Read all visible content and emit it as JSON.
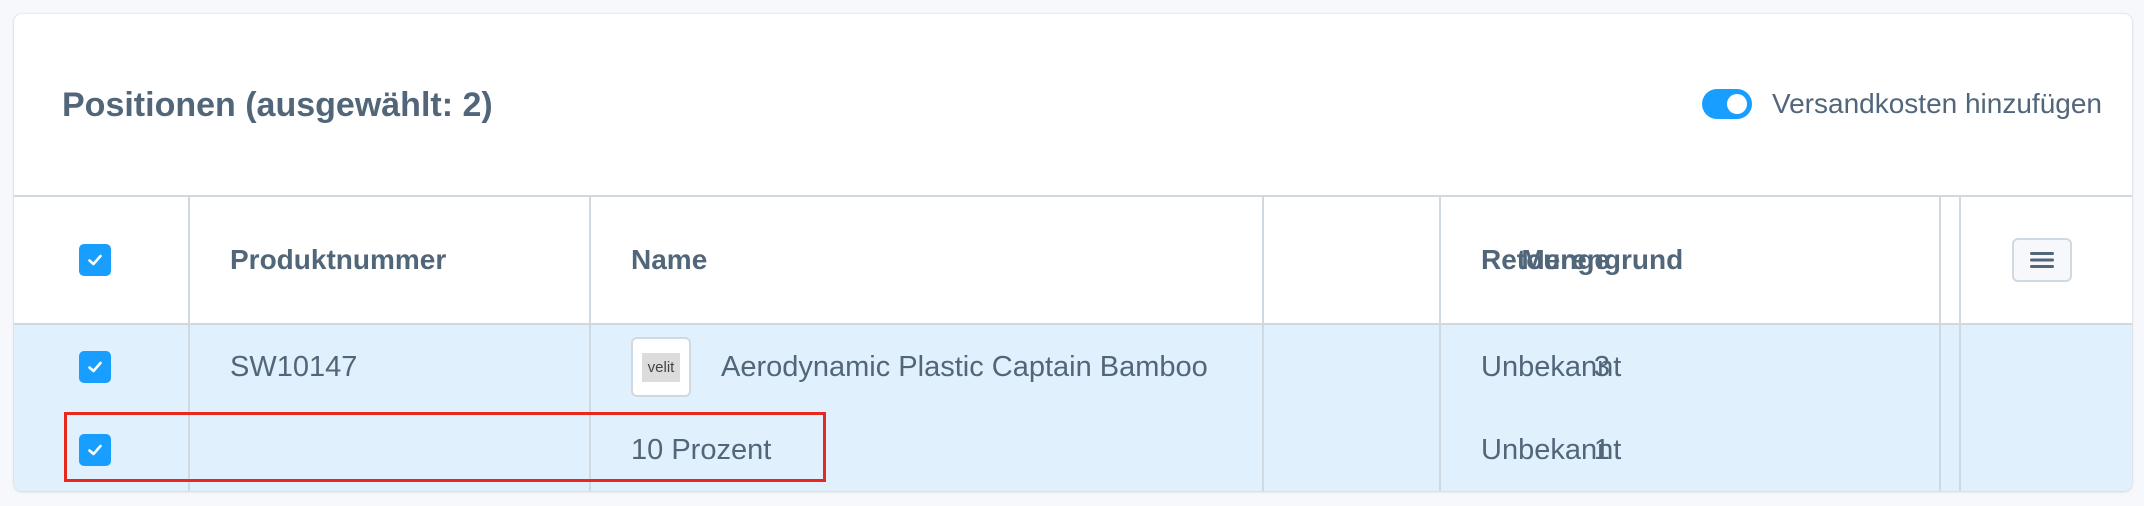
{
  "header": {
    "title": "Positionen (ausgewählt: 2)",
    "shipping_toggle_label": "Versandkosten hinzufügen",
    "shipping_toggle_on": true
  },
  "table": {
    "columns": [
      "Produktnummer",
      "Name",
      "Menge",
      "Retourengrund"
    ],
    "rows": [
      {
        "selected": true,
        "product_number": "SW10147",
        "thumbnail_text": "velit",
        "name": "Aerodynamic Plastic Captain Bamboo",
        "quantity": "3",
        "return_reason": "Unbekannt"
      },
      {
        "selected": true,
        "product_number": "",
        "name": "10 Prozent",
        "quantity": "1",
        "return_reason": "Unbekannt"
      }
    ]
  },
  "icons": {
    "checkbox": "checkmark-icon",
    "settings": "menu-lines-icon"
  },
  "colors": {
    "accent": "#189eff",
    "row_selected_bg": "#e0f0fd",
    "highlight": "#e6281e",
    "text": "#52667a"
  }
}
